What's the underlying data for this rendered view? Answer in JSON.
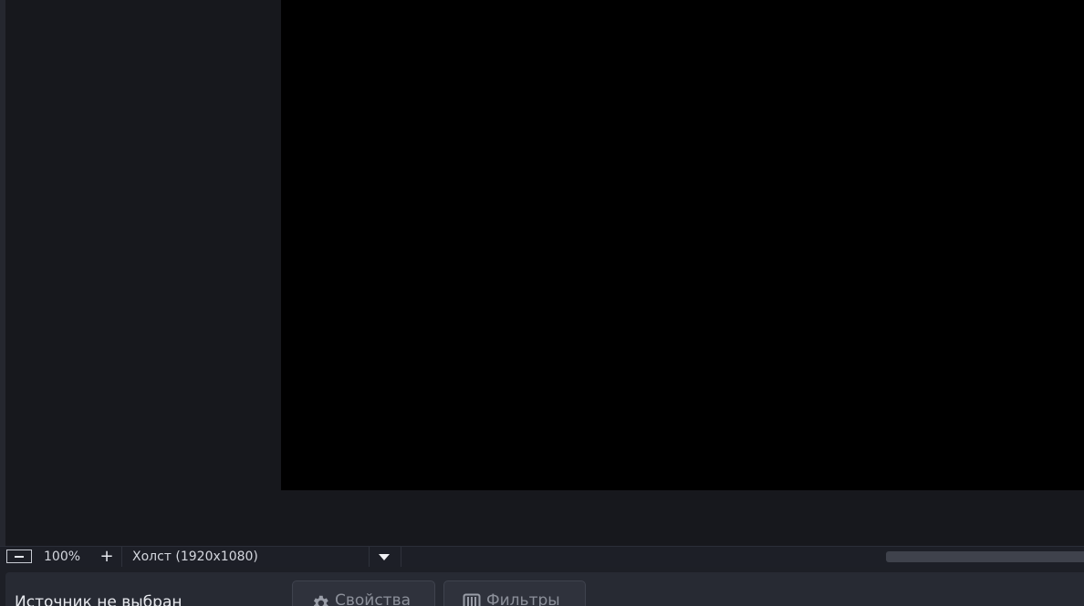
{
  "zoom_bar": {
    "zoom_value": "100%",
    "zoom_in_symbol": "+",
    "canvas_select": "Холст (1920x1080)"
  },
  "context_bar": {
    "no_source_label": "Источник не выбран",
    "properties_button": "Свойства",
    "filters_button": "Фильтры"
  },
  "icons": {
    "zoom_out": "minus-icon",
    "dropdown": "chevron-down-icon",
    "properties": "gear-icon",
    "filters": "filter-icon"
  },
  "colors": {
    "background": "#1d1f26",
    "preview_background": "#17181d",
    "canvas": "#000000",
    "panel": "#272a33",
    "button": "#2f323c",
    "disabled_text": "#8c909a"
  }
}
